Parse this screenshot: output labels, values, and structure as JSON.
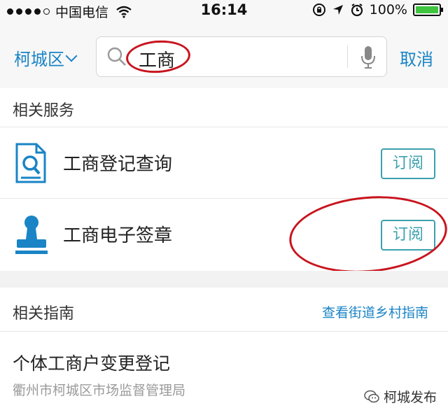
{
  "status_bar": {
    "carrier": "中国电信",
    "time": "16:14",
    "battery": "100%",
    "battery_color": "#3ec43e"
  },
  "header": {
    "city": "柯城区",
    "search_query": "工商",
    "cancel_label": "取消",
    "accent_color": "#1a84c6"
  },
  "services": {
    "title": "相关服务",
    "items": [
      {
        "label": "工商登记查询",
        "icon": "document-search-icon",
        "button": "订阅"
      },
      {
        "label": "工商电子签章",
        "icon": "stamp-icon",
        "button": "订阅"
      }
    ]
  },
  "guides": {
    "title": "相关指南",
    "link": "查看街道乡村指南",
    "items": [
      {
        "title": "个体工商户变更登记",
        "subtitle": "衢州市柯城区市场监督管理局"
      }
    ]
  },
  "watermark": {
    "text": "柯城发布"
  },
  "annotations": {
    "ellipse_color": "#c8141e"
  }
}
